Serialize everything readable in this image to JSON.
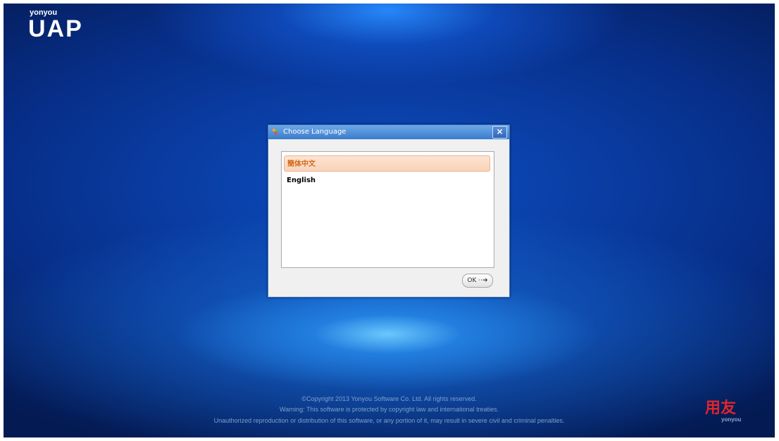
{
  "branding": {
    "small_logo": "yonyou",
    "product": "UAP",
    "brand_cn": "用友",
    "brand_en": "yonyou"
  },
  "dialog": {
    "title": "Choose Language",
    "close_glyph": "×",
    "languages": [
      "簡体中文",
      "English"
    ],
    "selected_index": 0,
    "ok_label": "OK",
    "ok_arrow": "··➔"
  },
  "footer": {
    "copyright": "©Copyright 2013 Yonyou Software Co. Ltd. All rights reserved.",
    "warning": "Warning: This software is protected by copyright law and international treaties.",
    "notice": "Unauthorized reproduction or distribution of this software, or any portion of it, may result in severe civil and criminal penalties."
  },
  "colors": {
    "title_bar": "#3a7ccc",
    "selected_text": "#d26a1e",
    "brand_red": "#e0252b"
  }
}
